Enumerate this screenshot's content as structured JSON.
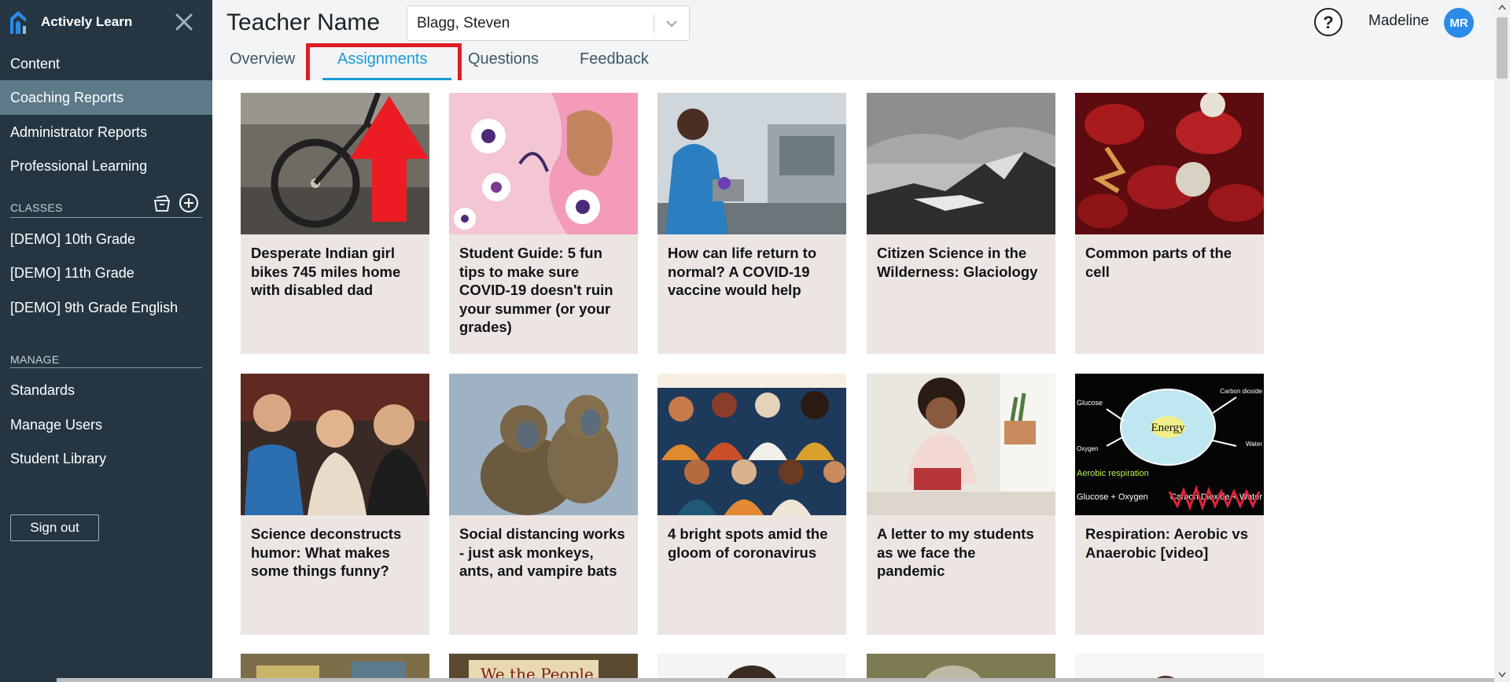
{
  "brand": {
    "name": "Actively Learn"
  },
  "sidebar": {
    "items": [
      {
        "label": "Content"
      },
      {
        "label": "Coaching Reports"
      },
      {
        "label": "Administrator Reports"
      },
      {
        "label": "Professional Learning"
      }
    ],
    "classes_label": "CLASSES",
    "classes": [
      {
        "label": "[DEMO] 10th Grade"
      },
      {
        "label": "[DEMO] 11th Grade"
      },
      {
        "label": "[DEMO] 9th Grade English"
      }
    ],
    "manage_label": "MANAGE",
    "manage": [
      {
        "label": "Standards"
      },
      {
        "label": "Manage Users"
      },
      {
        "label": "Student Library"
      }
    ],
    "signout_label": "Sign out"
  },
  "header": {
    "title": "Teacher Name",
    "selected_teacher": "Blagg, Steven",
    "user_name": "Madeline",
    "user_initials": "MR",
    "help_glyph": "?"
  },
  "tabs": [
    {
      "label": "Overview"
    },
    {
      "label": "Assignments"
    },
    {
      "label": "Questions"
    },
    {
      "label": "Feedback"
    }
  ],
  "cards": [
    {
      "title": "Desperate Indian girl bikes 745 miles home with disabled dad"
    },
    {
      "title": "Student Guide: 5 fun tips to make sure COVID-19 doesn't ruin your summer (or your grades)"
    },
    {
      "title": "How can life return to normal? A COVID-19 vaccine would help"
    },
    {
      "title": "Citizen Science in the Wilderness: Glaciology"
    },
    {
      "title": "Common parts of the cell"
    },
    {
      "title": "Science deconstructs humor: What makes some things funny?"
    },
    {
      "title": "Social distancing works - just ask monkeys, ants, and vampire bats"
    },
    {
      "title": "4 bright spots amid the gloom of coronavirus"
    },
    {
      "title": "A letter to my students as we face the pandemic"
    },
    {
      "title": "Respiration: Aerobic vs Anaerobic [video]"
    }
  ],
  "thumb_text": {
    "energy": "Energy",
    "glucose": "Glucose",
    "oxygen": "Oxygen",
    "carbon_dioxide": "Carbon dioxide",
    "water": "Water",
    "aerobic": "Aerobic respiration",
    "equation_left": "Glucose + Oxygen",
    "equation_right": "Carbon Dioxide + Water",
    "we_the_people": "We the People"
  },
  "colors": {
    "sidebar_bg": "#253642",
    "sidebar_active": "#5c7a87",
    "accent": "#1a9bd7",
    "highlight": "#e01b24",
    "card_bg": "#ede5e2",
    "avatar": "#2a8be8"
  },
  "icons": {
    "logo": "actively-learn-logo",
    "close": "close-x-icon",
    "archive": "archive-icon",
    "add": "add-circle-icon",
    "chevron": "chevron-down-icon",
    "help": "help-icon",
    "arrow": "red-arrow-annotation"
  }
}
